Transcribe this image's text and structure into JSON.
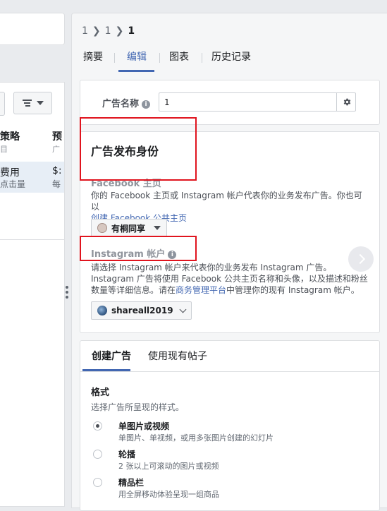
{
  "left_panel": {
    "col1_header": "策略",
    "col1_sub": "目",
    "col2_header": "预",
    "col2_sub": "广",
    "row_col1_value": "费用",
    "row_col1_sub": "点击量",
    "row_col2_value": "$:",
    "row_col2_sub": "每"
  },
  "breadcrumb": [
    "1",
    "1",
    "1"
  ],
  "tabs": [
    "摘要",
    "编辑",
    "图表",
    "历史记录"
  ],
  "active_tab": "编辑",
  "ad_name": {
    "label": "广告名称",
    "value": "1"
  },
  "identity": {
    "title": "广告发布身份",
    "facebook_label": "Facebook 主页",
    "facebook_desc": "你的 Facebook 主页或 Instagram 帐户代表你的业务发布广告。你也可以",
    "facebook_link": "创建 Facebook 公共主页",
    "page_selected": "有桐同享",
    "instagram_label": "Instagram 帐户",
    "instagram_desc_1": "请选择 Instagram 帐户来代表你的业务发布 Instagram 广告。Instagram 广告将使用 Facebook 公共主页名称和头像，以及描述和粉丝数量等详细信息。请在",
    "instagram_link": "商务管理平台",
    "instagram_desc_2": "中管理你的现有 Instagram 帐户。",
    "instagram_selected": "shareall2019"
  },
  "create": {
    "tabs": [
      "创建广告",
      "使用现有帖子"
    ],
    "active_tab": "创建广告",
    "format_title": "格式",
    "format_sub": "选择广告所呈现的样式。",
    "options": [
      {
        "title": "单图片或视频",
        "sub": "单图片、单视频，或用多张图片创建的幻灯片",
        "checked": true
      },
      {
        "title": "轮播",
        "sub": "2 张以上可滚动的图片或视频",
        "checked": false
      },
      {
        "title": "精品栏",
        "sub": "用全屏移动体验呈现一组商品",
        "checked": false
      }
    ]
  },
  "colors": {
    "accent": "#4267b2",
    "highlight_box": "#e0141e"
  },
  "icons": {
    "list_view": "lines-icon",
    "settings": "gear-icon",
    "info": "info-icon",
    "next": "chevron-right-icon"
  }
}
